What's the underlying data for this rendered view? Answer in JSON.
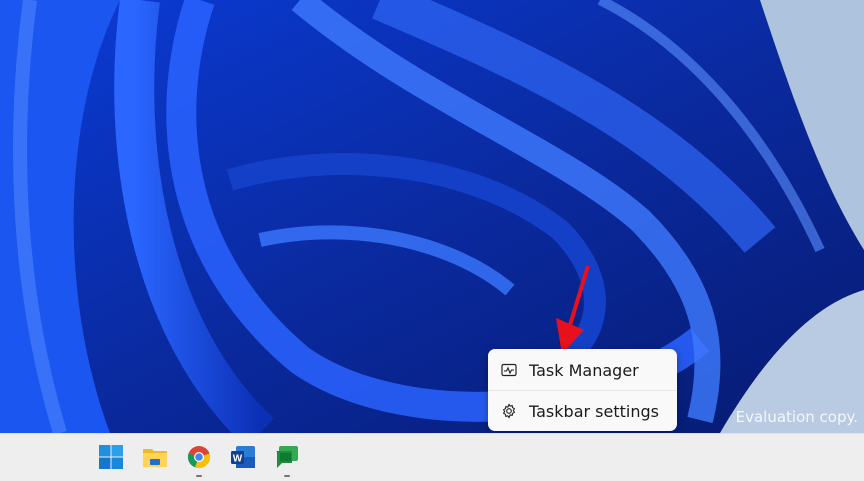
{
  "desktop": {
    "watermark": "Evaluation copy."
  },
  "context_menu": {
    "items": [
      {
        "label": "Task Manager",
        "icon": "task-manager-icon"
      },
      {
        "label": "Taskbar settings",
        "icon": "gear-icon"
      }
    ]
  },
  "taskbar": {
    "apps": [
      {
        "name": "Start",
        "icon": "windows-logo-icon",
        "running": false
      },
      {
        "name": "File Explorer",
        "icon": "folder-icon",
        "running": false
      },
      {
        "name": "Google Chrome",
        "icon": "chrome-icon",
        "running": true
      },
      {
        "name": "Microsoft Word",
        "icon": "word-icon",
        "running": false
      },
      {
        "name": "Google Chat",
        "icon": "chat-icon",
        "running": true
      }
    ]
  },
  "colors": {
    "annotation_arrow": "#e8101c",
    "accent": "#1a4fe8"
  }
}
